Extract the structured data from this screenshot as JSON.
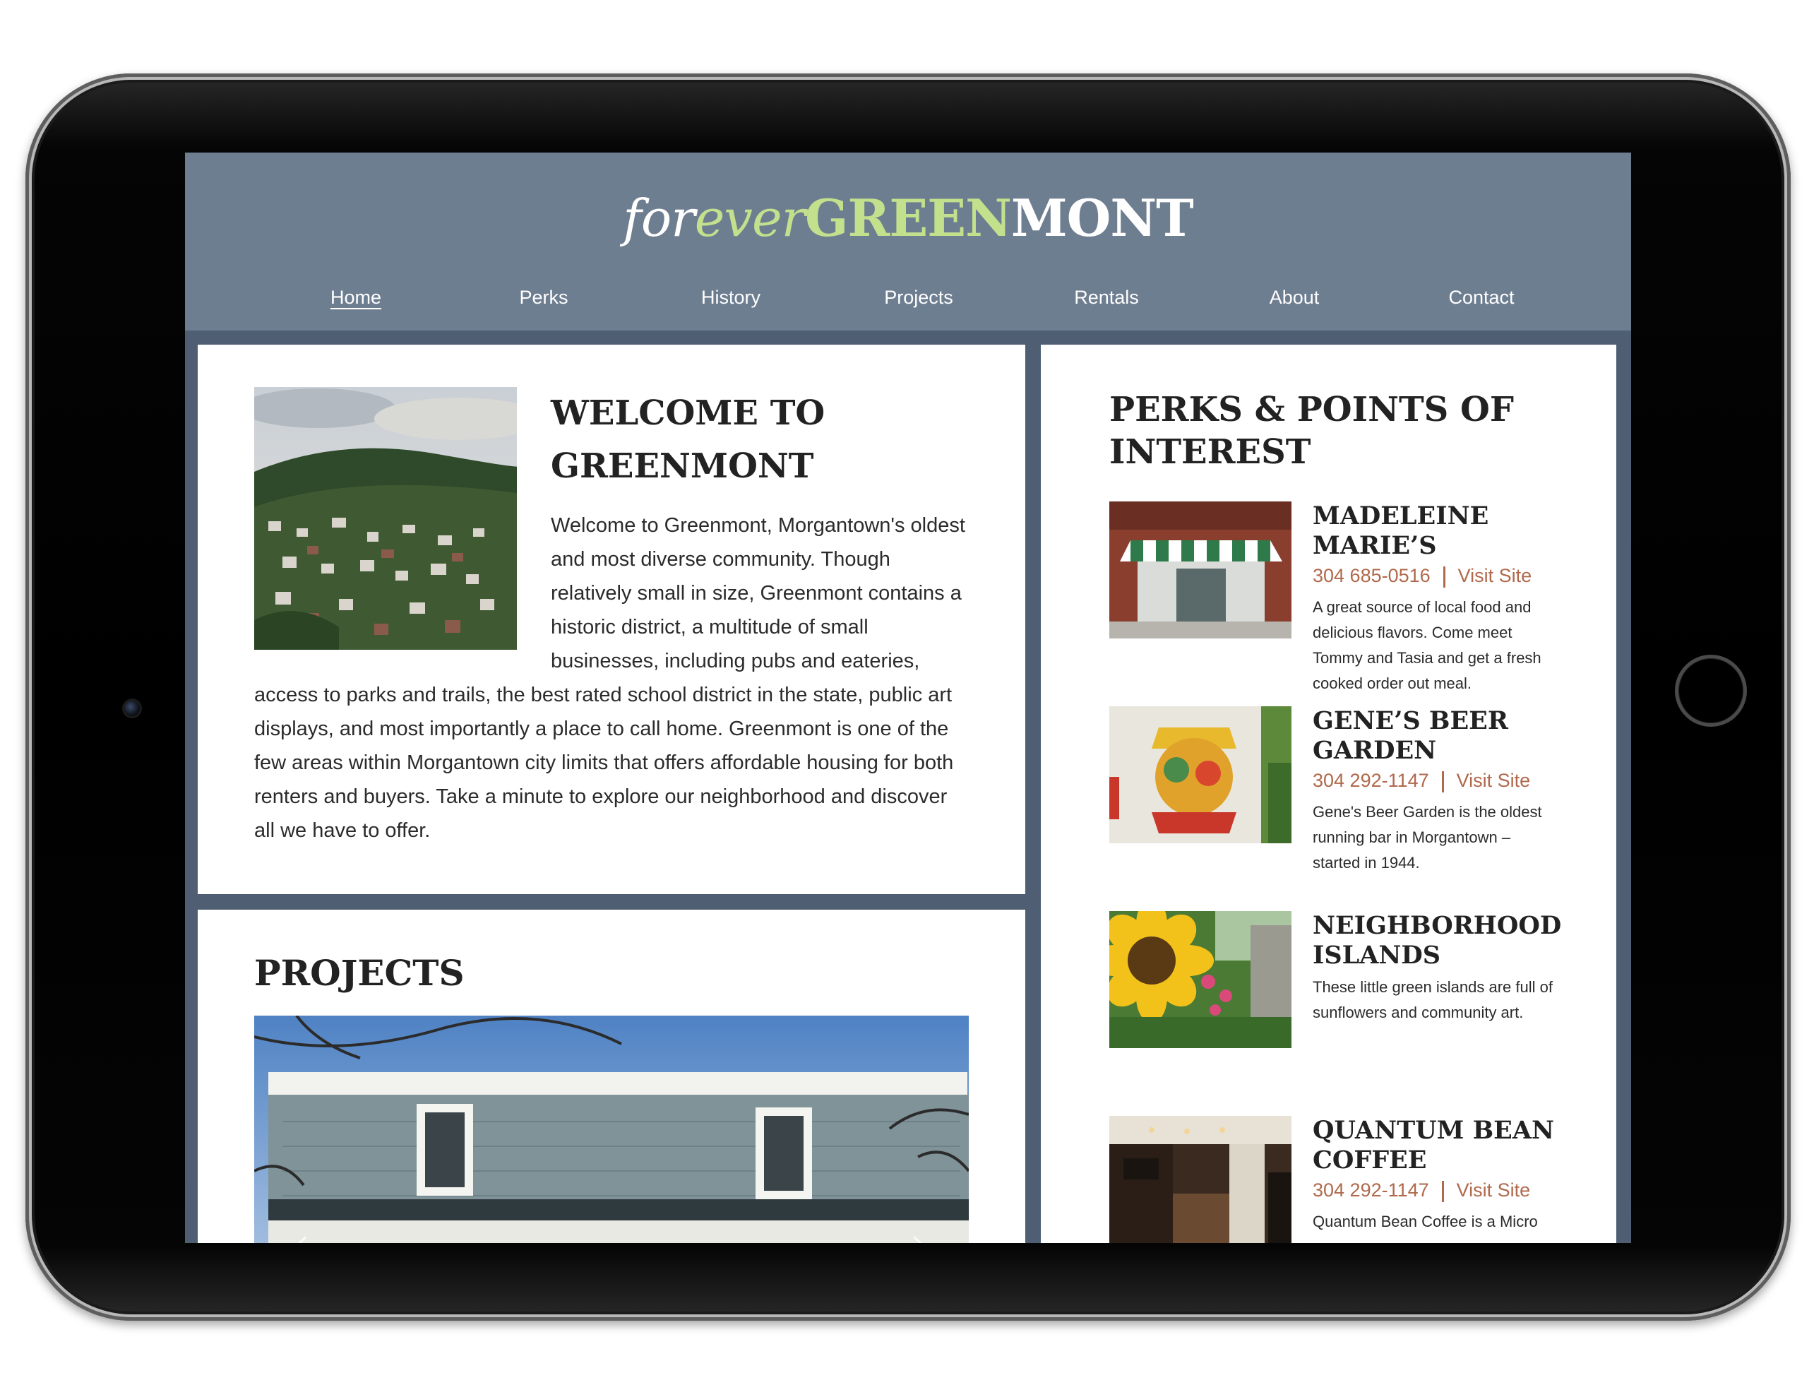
{
  "site": {
    "logo": {
      "part1": "for",
      "part2": "ever",
      "part3": "GREEN",
      "part4": "MONT"
    },
    "nav": [
      {
        "label": "Home",
        "active": true
      },
      {
        "label": "Perks"
      },
      {
        "label": "History"
      },
      {
        "label": "Projects"
      },
      {
        "label": "Rentals"
      },
      {
        "label": "About"
      },
      {
        "label": "Contact"
      }
    ]
  },
  "welcome": {
    "title": "WELCOME TO GREENMONT",
    "text": "Welcome to Greenmont, Morgantown's oldest and most diverse community. Though relatively small in size, Greenmont contains a historic district, a multitude of small businesses, including pubs and eateries, access to parks and trails, the best rated school district in the state, public art displays, and most importantly a place to call home. Greenmont is one of the few areas within Morgantown city limits that offers affordable housing for both renters and buyers. Take a minute to explore our neighborhood and discover all we have to offer.",
    "photo_icon": "hillside-town-photo"
  },
  "projects": {
    "title": "PROJECTS",
    "photo_icon": "house-photo",
    "prev_icon": "‹",
    "next_icon": "›"
  },
  "perks": {
    "title": "PERKS & POINTS OF INTEREST",
    "items": [
      {
        "name": "MADELEINE MARIE’S",
        "phone": "304 685-0516",
        "link": "Visit Site",
        "desc": "A great source of local food and delicious flavors. Come meet Tommy and Tasia and get a fresh cooked order out meal.",
        "photo_icon": "storefront-photo"
      },
      {
        "name": "GENE’S BEER GARDEN",
        "phone": "304 292-1147",
        "link": "Visit Site",
        "desc": "Gene's Beer Garden is the oldest running bar in Morgantown – started in 1944.",
        "photo_icon": "mural-photo"
      },
      {
        "name": "NEIGHBORHOOD ISLANDS",
        "phone": "",
        "link": "",
        "desc": "These little green islands are full of sunflowers and community art.",
        "photo_icon": "sunflower-photo"
      },
      {
        "name": "QUANTUM BEAN COFFEE",
        "phone": "304 292-1147",
        "link": "Visit Site",
        "desc": "Quantum Bean Coffee is a Micro",
        "photo_icon": "coffee-shop-photo"
      }
    ]
  },
  "colors": {
    "header_bg": "#6e7e91",
    "page_bg": "#4f5e72",
    "accent_green": "#c3e08d",
    "link_rust": "#b0694c"
  }
}
